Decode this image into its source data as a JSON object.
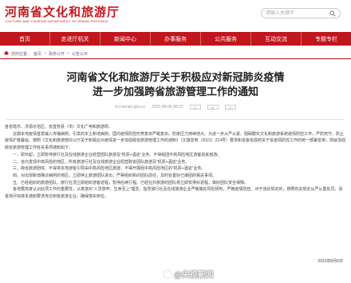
{
  "header": {
    "title": "河南省文化和旅游厅",
    "subtitle": "CULTURE AND TOURISM DEPARTMENT OF HENAN PROVINCE",
    "search_placeholder": "请输入关键字"
  },
  "nav": [
    "首页",
    "走进厅机关",
    "新闻中心",
    "办事服务",
    "公共服务",
    "互动交流",
    "专题专栏"
  ],
  "breadcrumb": {
    "label": "您的位置：",
    "items": [
      "首页",
      "政务公开",
      "公告公示"
    ]
  },
  "article": {
    "title_line1": "河南省文化和旅游厅关于积极应对新冠肺炎疫情",
    "title_line2": "进一步加强跨省旅游管理工作的通知",
    "source": "hct.henan.gov.cn",
    "datetime": "2021-08-06 08:37",
    "recipient": "各省辖市、济源示范区、省直管县（市）文化广电和旅游局：",
    "p1": "近期本地疫情首发输入传播病例，引发的本土新增病例，国内疫情防控形势复杂严峻复杂。防疫压力持续增大。为进一步从严从紧、阻碍群实文化和旅游系统疫情防控工作，严防死守，防止疫情扩散蔓延。按照《文化和旅游部办公厅关于积极应对疫情进一步加强跨省旅游管理工作的通知》（文旅发电〔2021〕214号）要求和省委省政府关于省疫情防控工作的统一部署安排，现就加强跨省旅游管理工作有关事项通知如下：",
    "items": [
      "一、即日起，立即暂停旅行社及在线旅游企业经营团队旅游及“机票+酒店”业务。不得组团中高风险地区游客前来旅游。",
      "二、省内发现中高风险的地区，所有旅游行社及在线旅游企业经营跨省团队旅游及“机票+酒店”业务。",
      "三、跨省旅游团体、不得将本地游客引导由中高风险地区旅游，不得开展经中高风险地区的“机票+酒店”业务。",
      "四、对出现新增确诊病例的地区，立即停止旅游团队进出，严禁组织新的团队前往，及时处置好已接团的相关事项。",
      "五、已经组织的旅游团队，旅行社须立即组织游客返程，暂停后续行程。已经在外旅游的团队将立即安排好返程，做好团队安全保障。"
    ],
    "p2": "各地要高度认识此项工作的重要性，认真落实“人员筑牢、生命至上”理念，指导旅行社及在线旅游企业严格做好风险研判，严格疫情防控。对于违反规定的，按照有关规定从严从重处罚。请各地尽快将本通知要求传达到各旅游企业，确保落实到位。",
    "date": "2021年8月6日"
  },
  "watermark": "@央视新闻"
}
